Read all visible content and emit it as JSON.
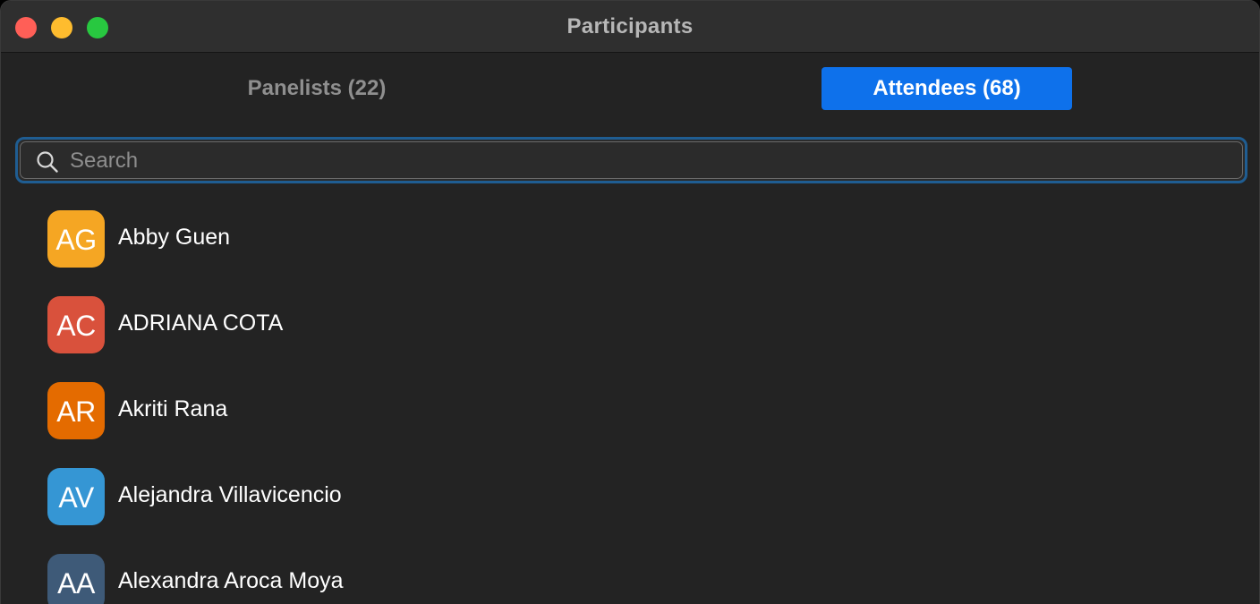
{
  "window": {
    "title": "Participants"
  },
  "tabs": {
    "panelists": "Panelists (22)",
    "attendees": "Attendees (68)",
    "active": "attendees"
  },
  "search": {
    "placeholder": "Search",
    "value": ""
  },
  "attendees": [
    {
      "initials": "AG",
      "name": "Abby Guen",
      "color": "#f5a623"
    },
    {
      "initials": "AC",
      "name": "ADRIANA COTA",
      "color": "#d9513c"
    },
    {
      "initials": "AR",
      "name": "Akriti Rana",
      "color": "#e46b00"
    },
    {
      "initials": "AV",
      "name": "Alejandra Villavicencio",
      "color": "#3596d4"
    },
    {
      "initials": "AA",
      "name": "Alexandra Aroca Moya",
      "color": "#3e5a78"
    }
  ],
  "colors": {
    "active_tab": "#0e71eb",
    "search_focus": "#1f5d92",
    "background": "#232323"
  }
}
